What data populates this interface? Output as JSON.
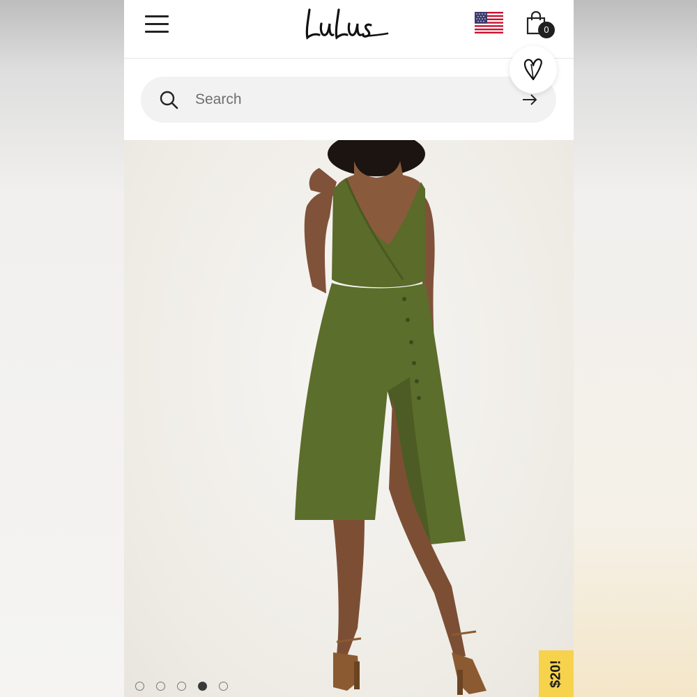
{
  "header": {
    "logo_text": "Lulus",
    "cart_count": "0",
    "icons": {
      "menu": "hamburger-menu-icon",
      "flag": "us-flag-icon",
      "cart": "shopping-bag-icon"
    }
  },
  "search": {
    "placeholder": "Search",
    "icons": {
      "search": "magnifier-icon",
      "submit": "arrow-right-icon"
    }
  },
  "wishlist": {
    "icon": "heart-icon"
  },
  "carousel": {
    "dot_count": 5,
    "active_index": 3
  },
  "promo": {
    "label": "$20!"
  },
  "colors": {
    "header_bg": "#ffffff",
    "search_bg": "#f2f2f2",
    "promo_bg": "#f7d34d",
    "dress_green": "#5a6b2a",
    "text_dark": "#1c1c1c"
  }
}
